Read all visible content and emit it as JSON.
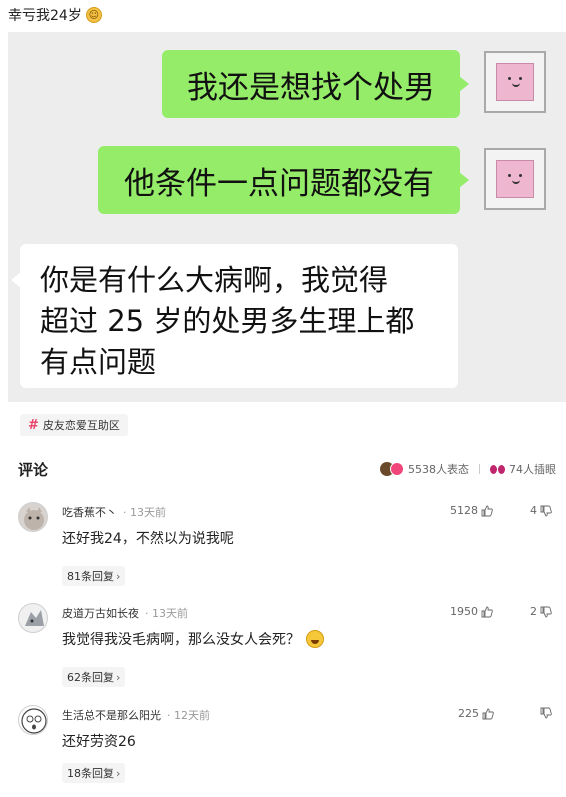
{
  "post": {
    "title": "幸亏我24岁"
  },
  "chat": {
    "messages": [
      {
        "side": "right",
        "text": "我还是想找个处男"
      },
      {
        "side": "right",
        "text": "他条件一点问题都没有"
      },
      {
        "side": "left",
        "lines": [
          "你是有什么大病啊，我觉得",
          "超过 25 岁的处男多生理上都",
          "有点问题"
        ]
      }
    ]
  },
  "topic": {
    "hash": "#",
    "label": "皮友恋爱互助区"
  },
  "comments_header": {
    "title": "评论",
    "reactions": "5538人表态",
    "watchers": "74人插眼"
  },
  "comments": [
    {
      "user": "吃香蕉不丶",
      "time": "13天前",
      "likes": "5128",
      "dislikes": "4",
      "text": "还好我24，不然以为说我呢",
      "replies": "81条回复"
    },
    {
      "user": "皮道万古如长夜",
      "time": "13天前",
      "likes": "1950",
      "dislikes": "2",
      "text": "我觉得我没毛病啊，那么没女人会死？",
      "replies": "62条回复"
    },
    {
      "user": "生活总不是那么阳光",
      "time": "12天前",
      "likes": "225",
      "dislikes": "",
      "text": "还好劳资26",
      "replies": "18条回复"
    }
  ],
  "colors": {
    "chat_bg": "#ededed",
    "bubble_green": "#95ec69",
    "tag_pink": "#e8426a"
  }
}
